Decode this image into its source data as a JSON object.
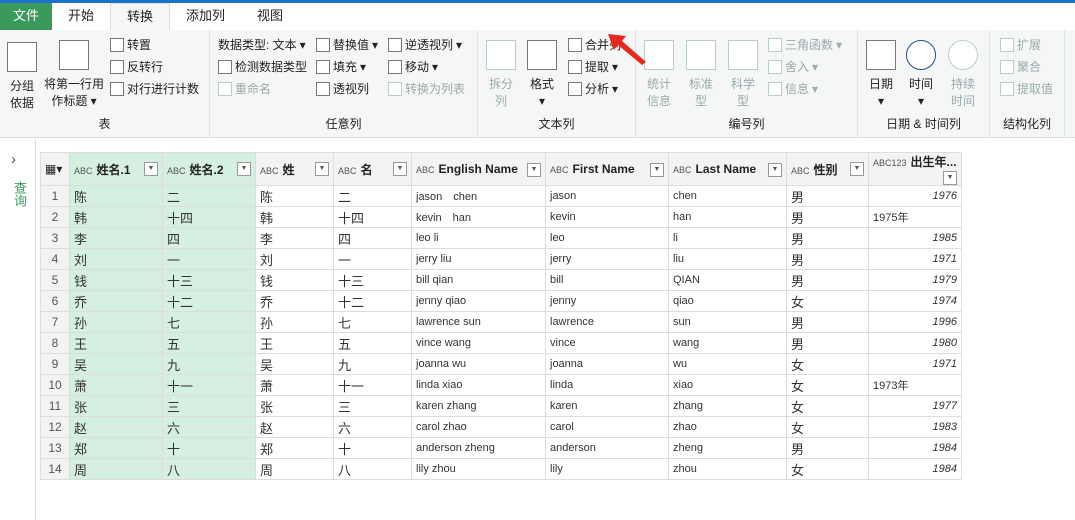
{
  "tabs": [
    "文件",
    "开始",
    "转换",
    "添加列",
    "视图"
  ],
  "ribbon": {
    "table": {
      "label": "表",
      "group_by": "分组依据",
      "first_row": "将第一行用作标题",
      "transpose": "转置",
      "reverse": "反转行",
      "count": "对行进行计数"
    },
    "any": {
      "label": "任意列",
      "dtype": "数据类型: 文本",
      "detect": "检测数据类型",
      "rename": "重命名",
      "replace": "替换值",
      "fill": "填充",
      "pivot": "透视列",
      "unpivot": "逆透视列",
      "move": "移动",
      "to_list": "转换为列表"
    },
    "text": {
      "label": "文本列",
      "split": "拆分列",
      "format": "格式",
      "merge": "合并列",
      "extract": "提取",
      "parse": "分析"
    },
    "number": {
      "label": "编号列",
      "stats": "统计信息",
      "standard": "标准型",
      "sci": "科学型",
      "trig": "三角函数",
      "round": "舍入",
      "info": "信息"
    },
    "datetime": {
      "label": "日期 & 时间列",
      "date": "日期",
      "time": "时间",
      "duration": "持续时间"
    },
    "struct": {
      "label": "结构化列",
      "expand": "扩展",
      "aggregate": "聚合",
      "extract_values": "提取值"
    }
  },
  "left_pane": {
    "label": "查询"
  },
  "grid": {
    "columns": [
      "姓名.1",
      "姓名.2",
      "姓",
      "名",
      "English Name",
      "First Name",
      "Last Name",
      "性别",
      "出生年..."
    ],
    "types": [
      "ABC",
      "ABC",
      "ABC",
      "ABC",
      "ABC",
      "ABC",
      "ABC",
      "ABC",
      "ABC123"
    ],
    "rows": [
      [
        "陈",
        "二",
        "陈",
        "二",
        "jason　chen",
        "jason",
        "chen",
        "男",
        "1976"
      ],
      [
        "韩",
        "十四",
        "韩",
        "十四",
        "kevin　han",
        "kevin",
        "han",
        "男",
        "1975年"
      ],
      [
        "李",
        "四",
        "李",
        "四",
        "leo li",
        "leo",
        "li",
        "男",
        "1985"
      ],
      [
        "刘",
        "一",
        "刘",
        "一",
        "jerry liu",
        "jerry",
        "liu",
        "男",
        "1971"
      ],
      [
        "钱",
        "十三",
        "钱",
        "十三",
        "bill qian",
        "bill",
        "QIAN",
        "男",
        "1979"
      ],
      [
        "乔",
        "十二",
        "乔",
        "十二",
        "jenny qiao",
        "jenny",
        "qiao",
        "女",
        "1974"
      ],
      [
        "孙",
        "七",
        "孙",
        "七",
        "lawrence sun",
        "lawrence",
        "sun",
        "男",
        "1996"
      ],
      [
        "王",
        "五",
        "王",
        "五",
        "vince wang",
        "vince",
        "wang",
        "男",
        "1980"
      ],
      [
        "吴",
        "九",
        "吴",
        "九",
        "joanna wu",
        "joanna",
        "wu",
        "女",
        "1971"
      ],
      [
        "萧",
        "十一",
        "萧",
        "十一",
        "linda xiao",
        "linda",
        "xiao",
        "女",
        "1973年"
      ],
      [
        "张",
        "三",
        "张",
        "三",
        "karen zhang",
        "karen",
        "zhang",
        "女",
        "1977"
      ],
      [
        "赵",
        "六",
        "赵",
        "六",
        "carol zhao",
        "carol",
        "zhao",
        "女",
        "1983"
      ],
      [
        "郑",
        "十",
        "郑",
        "十",
        "anderson zheng",
        "anderson",
        "zheng",
        "男",
        "1984"
      ],
      [
        "周",
        "八",
        "周",
        "八",
        "lily zhou",
        "lily",
        "zhou",
        "女",
        "1984"
      ]
    ]
  },
  "colors": {
    "accent": "#3a9a5c",
    "selected_col": "#d5efe1",
    "arrow": "#e8281e"
  }
}
